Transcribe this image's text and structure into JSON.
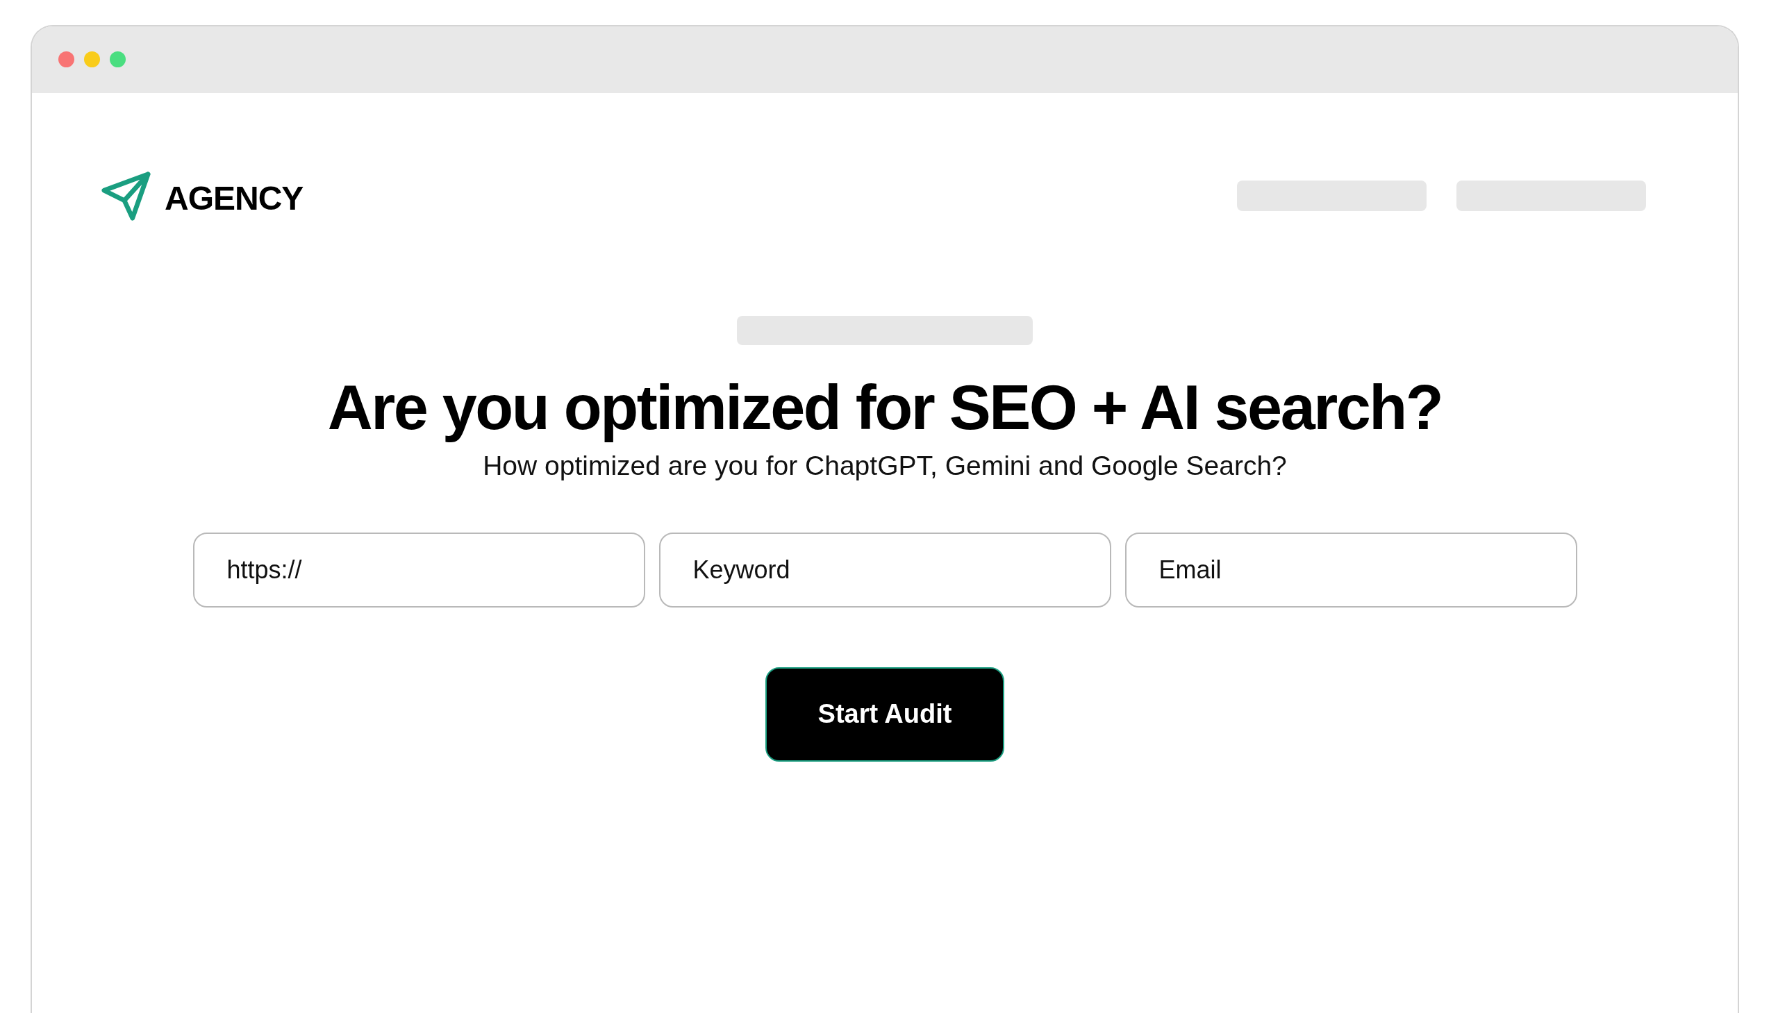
{
  "window": {
    "traffic_lights": [
      {
        "color": "#f87474"
      },
      {
        "color": "#f9cc1a"
      },
      {
        "color": "#4ade80"
      }
    ]
  },
  "header": {
    "logo_text": "AGENCY"
  },
  "hero": {
    "headline": "Are you optimized for SEO + AI search?",
    "subtitle": "How optimized are you for ChaptGPT, Gemini and Google Search?"
  },
  "form": {
    "fields": [
      {
        "placeholder": "https://"
      },
      {
        "placeholder": "Keyword"
      },
      {
        "placeholder": "Email"
      }
    ],
    "submit": "Start Audit"
  }
}
